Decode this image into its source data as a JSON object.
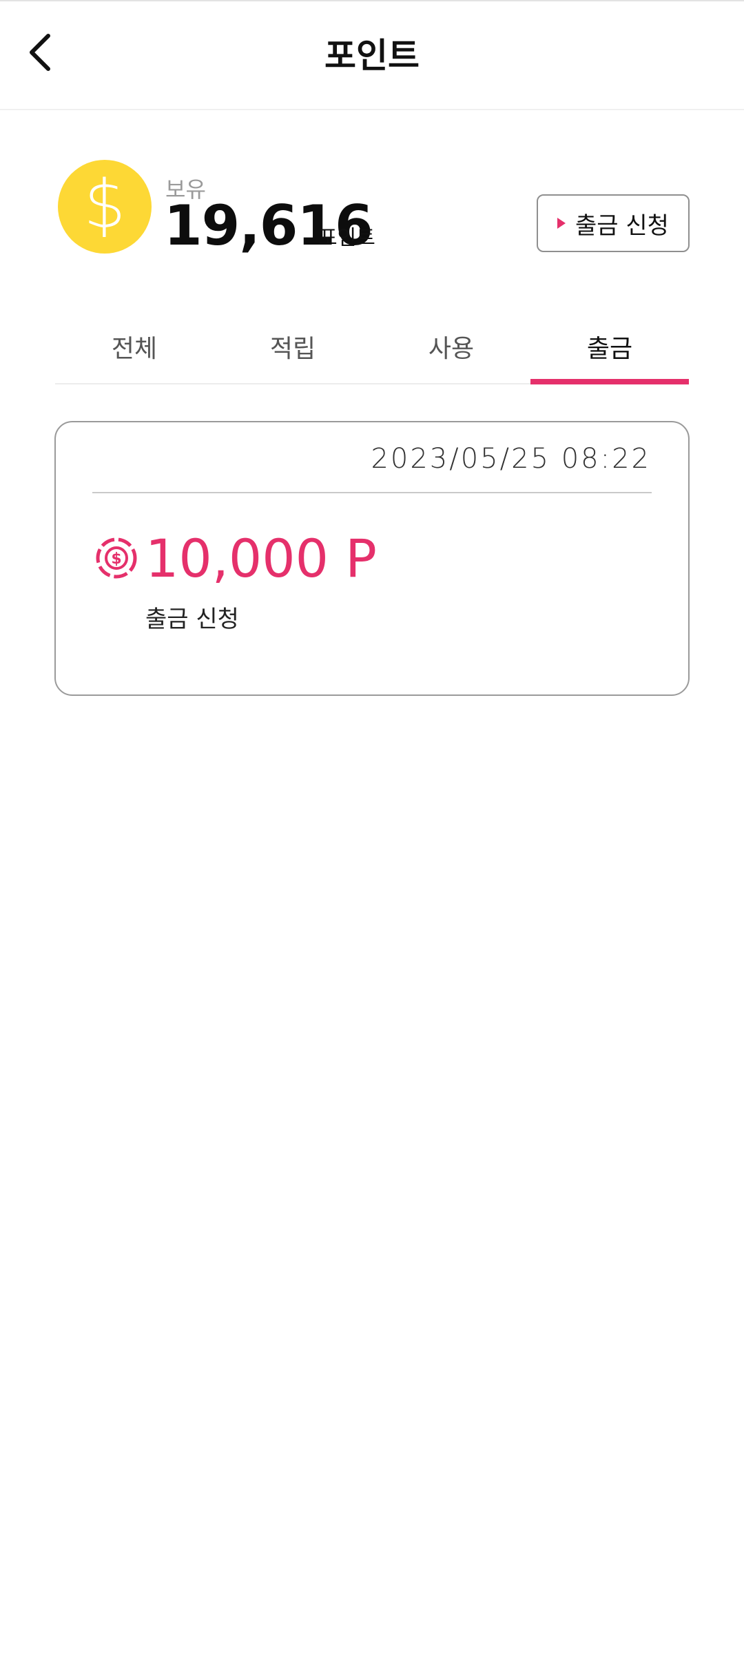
{
  "header": {
    "title": "포인트",
    "back_icon": "chevron-left-icon"
  },
  "balance": {
    "label": "보유",
    "amount": "19,616",
    "unit": "포인트",
    "coin_icon": "dollar-coin-icon",
    "withdraw_button_label": "출금 신청"
  },
  "tabs": [
    {
      "label": "전체",
      "active": false
    },
    {
      "label": "적립",
      "active": false
    },
    {
      "label": "사용",
      "active": false
    },
    {
      "label": "출금",
      "active": true
    }
  ],
  "history": [
    {
      "date": "2023/05/25 08:22",
      "amount": "10,000 P",
      "description": "출금 신청",
      "icon": "withdraw-coin-icon"
    }
  ],
  "colors": {
    "accent": "#e5306b",
    "coin": "#fdd835",
    "border": "#9a9a9a"
  }
}
